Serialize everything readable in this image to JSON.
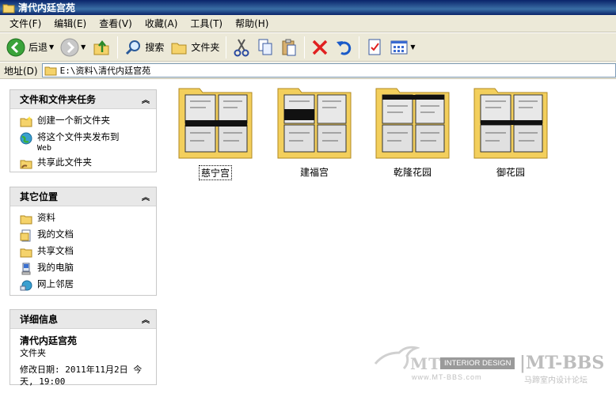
{
  "window": {
    "title": "清代内廷宫苑"
  },
  "menu": [
    "文件(F)",
    "编辑(E)",
    "查看(V)",
    "收藏(A)",
    "工具(T)",
    "帮助(H)"
  ],
  "toolbar": {
    "back": "后退",
    "search": "搜索",
    "folders": "文件夹"
  },
  "address": {
    "label": "地址(D)",
    "value": "E:\\资料\\清代内廷宫苑"
  },
  "tasks_panel": {
    "title": "文件和文件夹任务",
    "items": [
      "创建一个新文件夹",
      "将这个文件夹发布到",
      "Web",
      "共享此文件夹"
    ]
  },
  "places_panel": {
    "title": "其它位置",
    "items": [
      "资料",
      "我的文档",
      "共享文档",
      "我的电脑",
      "网上邻居"
    ]
  },
  "details_panel": {
    "title": "详细信息",
    "name": "清代内廷宫苑",
    "type": "文件夹",
    "modified_line1": "修改日期: 2011年11月2日 今",
    "modified_line2": "天, 19:00"
  },
  "folders": [
    {
      "name": "慈宁宫",
      "selected": true
    },
    {
      "name": "建福宫",
      "selected": false
    },
    {
      "name": "乾隆花园",
      "selected": false
    },
    {
      "name": "御花园",
      "selected": false
    }
  ],
  "watermark": {
    "mt": "MT",
    "interior": "INTERIOR DESIGN",
    "bbs": "|MT-BBS",
    "url": "www.MT-BBS.com",
    "cn": "马蹄室内设计论坛"
  }
}
